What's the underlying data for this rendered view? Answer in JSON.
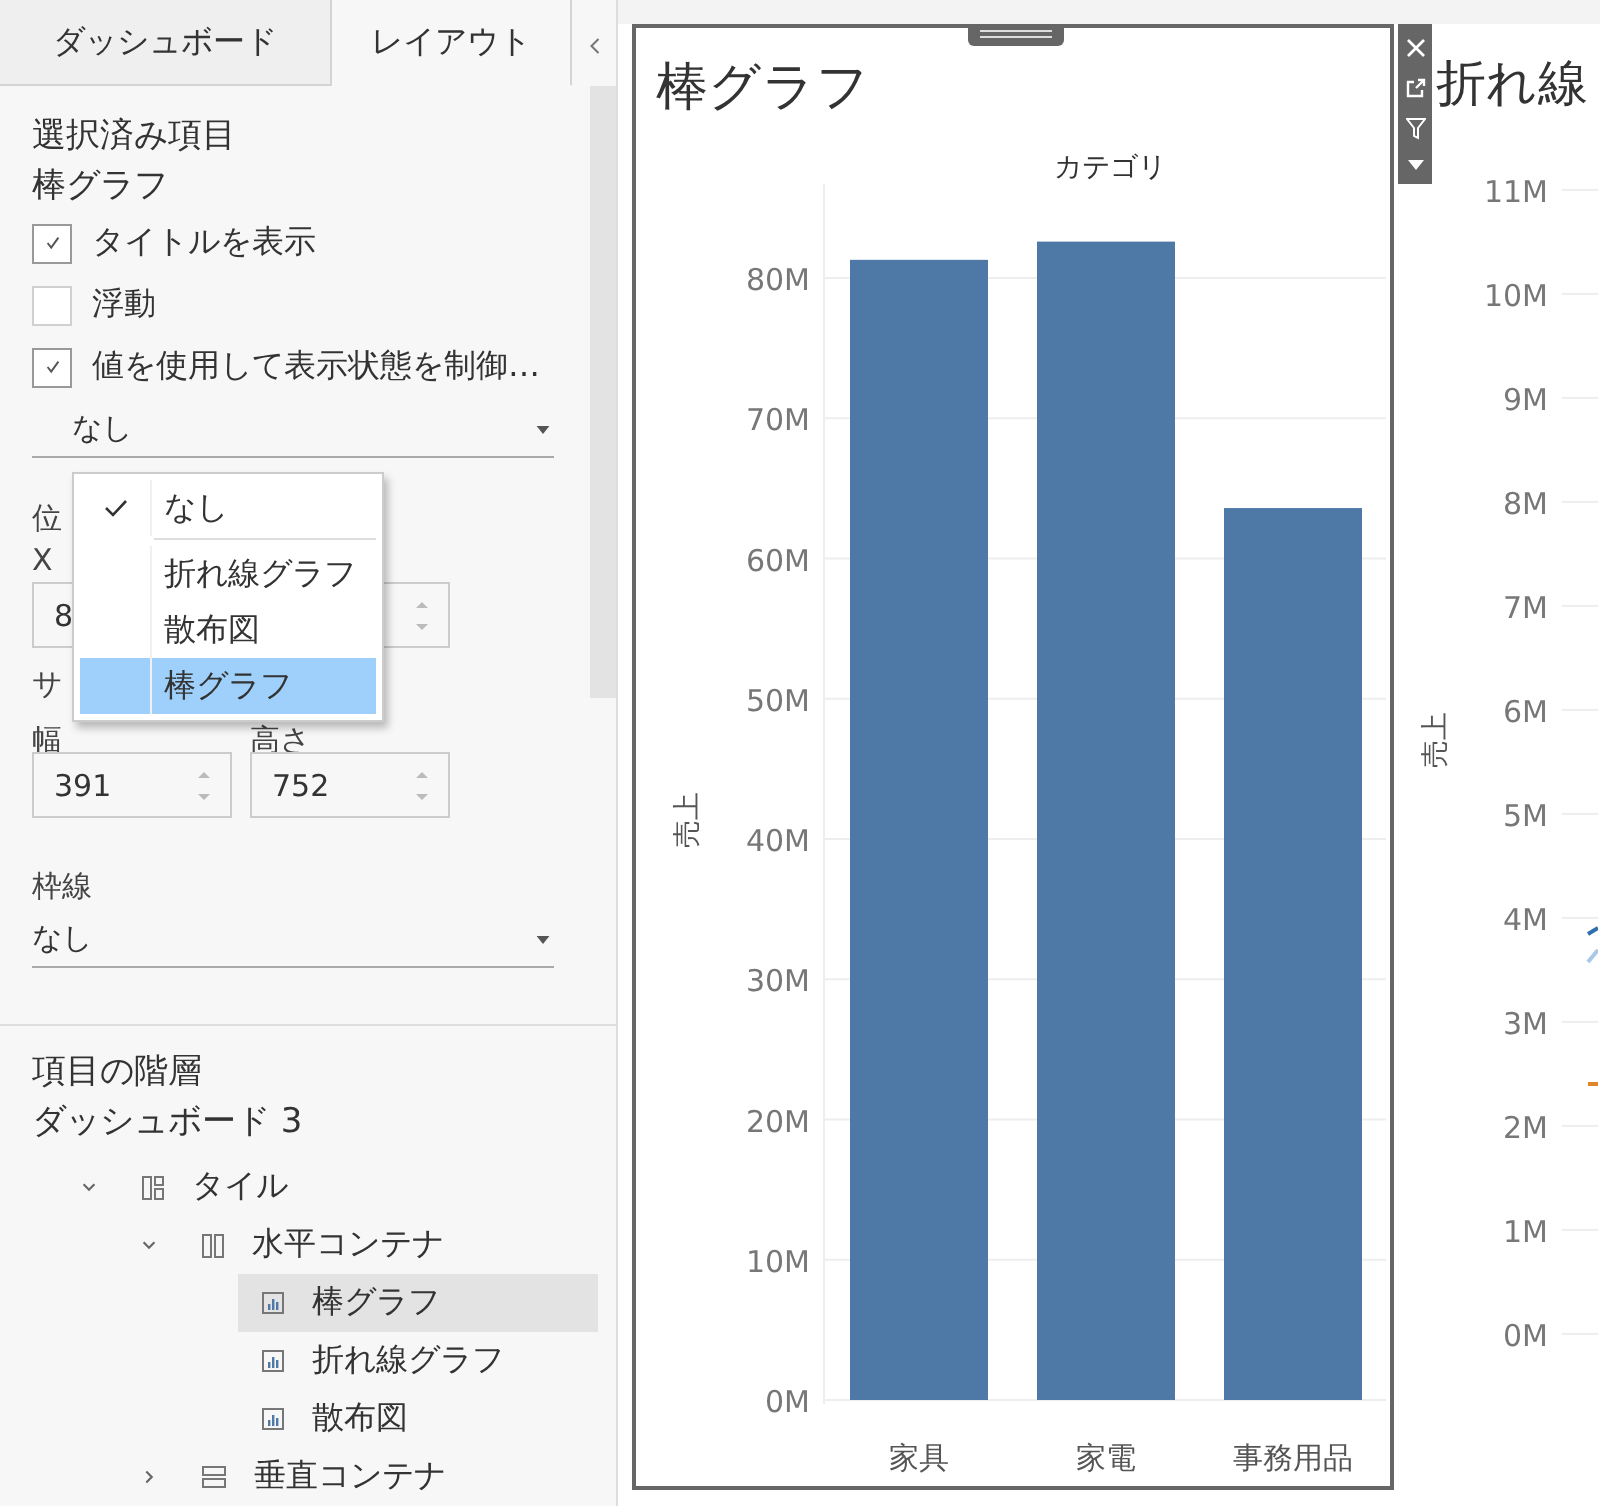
{
  "tabs": [
    {
      "label": "ダッシュボード",
      "selected": false
    },
    {
      "label": "レイアウト",
      "selected": true
    }
  ],
  "selected_item": {
    "heading": "選択済み項目",
    "name": "棒グラフ"
  },
  "options": [
    {
      "label": "タイトルを表示",
      "checked": true
    },
    {
      "label": "浮動",
      "checked": false
    },
    {
      "label": "値を使用して表示状態を制御…",
      "checked": true
    }
  ],
  "visibility_dropdown": {
    "value": "なし"
  },
  "position": {
    "label": "位",
    "x_label": "X",
    "x_value": "8"
  },
  "size": {
    "label": "サ",
    "width_label": "幅",
    "width_value": "391",
    "height_label": "高さ",
    "height_value": "752"
  },
  "border": {
    "label": "枠線",
    "value": "なし"
  },
  "menu": {
    "sections": [
      [
        {
          "label": "なし",
          "checked": true,
          "highlighted": false
        }
      ],
      [
        {
          "label": "折れ線グラフ",
          "checked": false,
          "highlighted": false
        },
        {
          "label": "散布図",
          "checked": false,
          "highlighted": false
        },
        {
          "label": "棒グラフ",
          "checked": false,
          "highlighted": true
        }
      ]
    ]
  },
  "hierarchy": {
    "heading": "項目の階層",
    "dashboard": "ダッシュボード 3",
    "tree": [
      {
        "label": "タイル",
        "kind": "tiled",
        "expanded": true,
        "selected": false,
        "children": [
          {
            "label": "水平コンテナ",
            "kind": "horizontal",
            "expanded": true,
            "selected": false,
            "children": [
              {
                "label": "棒グラフ",
                "kind": "sheet",
                "selected": true
              },
              {
                "label": "折れ線グラフ",
                "kind": "sheet",
                "selected": false
              },
              {
                "label": "散布図",
                "kind": "sheet",
                "selected": false
              }
            ]
          },
          {
            "label": "垂直コンテナ",
            "kind": "vertical",
            "expanded": false,
            "selected": false
          }
        ]
      }
    ]
  },
  "dashboard": {
    "bar_chart": {
      "title": "棒グラフ",
      "chart_data": {
        "type": "bar",
        "title": "カテゴリ",
        "ylabel": "売上",
        "categories": [
          "家具",
          "家電",
          "事務用品"
        ],
        "series": [
          {
            "color": "#4e79a7",
            "values": [
              81300000,
              82600000,
              63600000
            ]
          }
        ],
        "ylim": [
          0,
          83000000
        ],
        "grid": true,
        "yticks": [
          {
            "value": 0,
            "label": "0M"
          },
          {
            "value": 10000000,
            "label": "10M"
          },
          {
            "value": 20000000,
            "label": "20M"
          },
          {
            "value": 30000000,
            "label": "30M"
          },
          {
            "value": 40000000,
            "label": "40M"
          },
          {
            "value": 50000000,
            "label": "50M"
          },
          {
            "value": 60000000,
            "label": "60M"
          },
          {
            "value": 70000000,
            "label": "70M"
          },
          {
            "value": 80000000,
            "label": "80M"
          }
        ]
      }
    },
    "line_chart": {
      "title": "折れ線",
      "axis_title": "売上",
      "tick_labels": [
        "11M",
        "10M",
        "9M",
        "8M",
        "7M",
        "6M",
        "5M",
        "4M",
        "3M",
        "2M",
        "1M",
        "0M"
      ]
    }
  }
}
